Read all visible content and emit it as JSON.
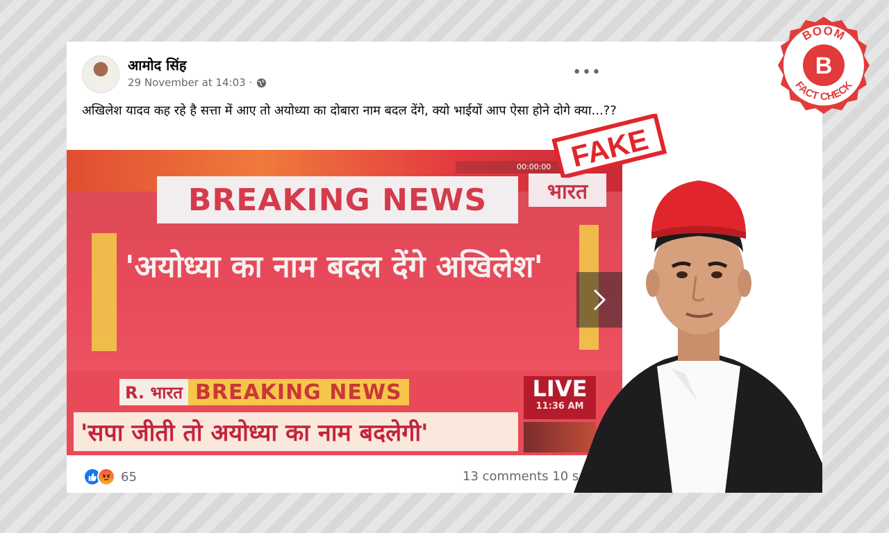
{
  "post": {
    "author": "आमोद सिंह",
    "timestamp": "29 November at 14:03 ·",
    "text": "अखिलेश यादव कह रहे है सत्ता में आए तो अयोध्या का दोबारा नाम बदल देंगे, क्यो भाईयों आप ऐसा होने दोगे क्या...??",
    "reaction_count": "65",
    "comments_shares": "13 comments  10 s"
  },
  "news_image": {
    "breaking_top": "BREAKING NEWS",
    "channel_top": "भारत",
    "headline": "'अयोध्या का नाम बदल देंगे अखिलेश'",
    "ticker_channel": "R. भारत",
    "ticker_breaking": "BREAKING NEWS",
    "ticker_line": "'सपा जीती तो अयोध्या का नाम बदलेगी'",
    "live": "LIVE",
    "live_time": "11:36 AM",
    "meter": "00:00:00"
  },
  "overlays": {
    "fake_stamp": "FAKE",
    "badge_top": "BOOM",
    "badge_letter": "B",
    "badge_bottom": "FACT CHECK"
  },
  "colors": {
    "boom_red": "#e23b3b",
    "fake_red": "#e0262c",
    "facebook_blue": "#1877f2"
  },
  "icons": [
    "globe-icon",
    "more-options-icon",
    "chevron-right-icon",
    "like-icon",
    "angry-icon"
  ]
}
